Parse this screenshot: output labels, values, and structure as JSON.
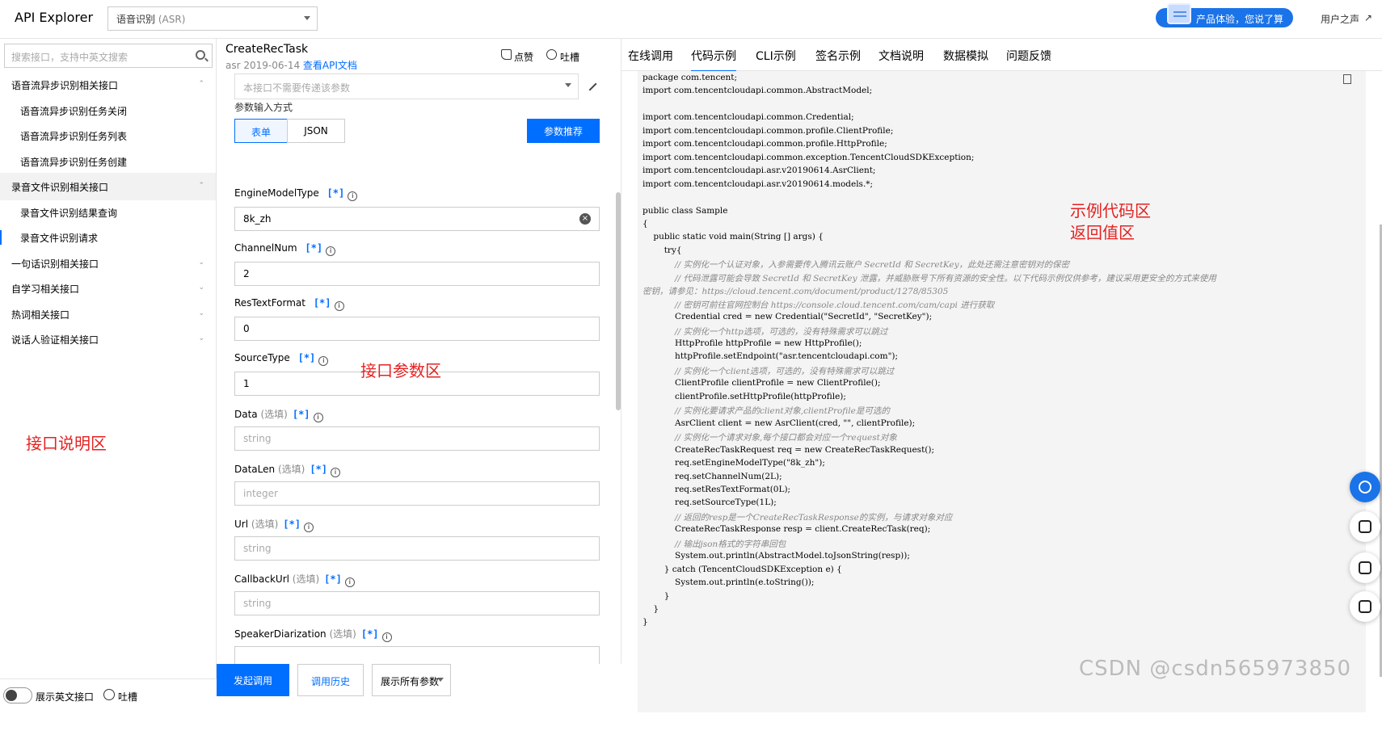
{
  "header": {
    "app_title": "API Explorer",
    "product_select": "语音识别",
    "product_select_sub": "(ASR)",
    "promo": "产品体验，您说了算",
    "voice": "用户之声"
  },
  "sidebar": {
    "search_placeholder": "搜索接口，支持中英文搜索",
    "items": [
      {
        "label": "语音流异步识别相关接口",
        "level": 0,
        "chev": "⌃"
      },
      {
        "label": "语音流异步识别任务关闭",
        "level": 1
      },
      {
        "label": "语音流异步识别任务列表",
        "level": 1
      },
      {
        "label": "语音流异步识别任务创建",
        "level": 1
      },
      {
        "label": "录音文件识别相关接口",
        "level": 0,
        "chev": "⌃"
      },
      {
        "label": "录音文件识别结果查询",
        "level": 1
      },
      {
        "label": "录音文件识别请求",
        "level": 1
      },
      {
        "label": "一句话识别相关接口",
        "level": 0,
        "chev": "⌄"
      },
      {
        "label": "自学习相关接口",
        "level": 0,
        "chev": "⌄"
      },
      {
        "label": "热词相关接口",
        "level": 0,
        "chev": "⌄"
      },
      {
        "label": "说话人验证相关接口",
        "level": 0,
        "chev": "⌄"
      }
    ],
    "note": "接口说明区",
    "toggle_label": "展示英文接口",
    "feedback": "吐槽"
  },
  "middle": {
    "task_title": "CreateRecTask",
    "task_meta": "asr 2019-06-14",
    "doc_link": "查看API文档",
    "like": "点赞",
    "complain": "吐槽",
    "hidden_placeholder": "本接口不需要传递该参数",
    "input_mode_label": "参数输入方式",
    "btn_form": "表单",
    "btn_json": "JSON",
    "btn_recommend": "参数推荐",
    "params": [
      {
        "name": "EngineModelType",
        "opt": "",
        "value": "8k_zh",
        "ph": false
      },
      {
        "name": "ChannelNum",
        "opt": "",
        "value": "2",
        "ph": false
      },
      {
        "name": "ResTextFormat",
        "opt": "",
        "value": "0",
        "ph": false
      },
      {
        "name": "SourceType",
        "opt": "",
        "value": "1",
        "ph": false
      },
      {
        "name": "Data",
        "opt": "(选填)",
        "value": "string",
        "ph": true
      },
      {
        "name": "DataLen",
        "opt": "(选填)",
        "value": "integer",
        "ph": true
      },
      {
        "name": "Url",
        "opt": "(选填)",
        "value": "string",
        "ph": true
      },
      {
        "name": "CallbackUrl",
        "opt": "(选填)",
        "value": "string",
        "ph": true
      },
      {
        "name": "SpeakerDiarization",
        "opt": "(选填)",
        "value": "",
        "ph": true
      }
    ],
    "star": "[*]",
    "note": "接口参数区",
    "btn_send": "发起调用",
    "btn_history": "调用历史",
    "btn_all": "展示所有参数"
  },
  "right": {
    "tabs": [
      "在线调用",
      "代码示例",
      "CLI示例",
      "签名示例",
      "文档说明",
      "数据模拟",
      "问题反馈"
    ],
    "active_tab": 1,
    "note_line1": "示例代码区",
    "note_line2": "返回值区",
    "code_lines": [
      "package com.tencent;",
      "import com.tencentcloudapi.common.AbstractModel;",
      "",
      "import com.tencentcloudapi.common.Credential;",
      "import com.tencentcloudapi.common.profile.ClientProfile;",
      "import com.tencentcloudapi.common.profile.HttpProfile;",
      "import com.tencentcloudapi.common.exception.TencentCloudSDKException;",
      "import com.tencentcloudapi.asr.v20190614.AsrClient;",
      "import com.tencentcloudapi.asr.v20190614.models.*;",
      "",
      "public class Sample",
      "{",
      "    public static void main(String [] args) {",
      "        try{",
      "            // 实例化一个认证对象，入参需要传入腾讯云账户 SecretId 和 SecretKey，此处还需注意密钥对的保密",
      "            // 代码泄露可能会导致 SecretId 和 SecretKey 泄露，并威胁账号下所有资源的安全性。以下代码示例仅供参考，建议采用更安全的方式来使用",
      "密钥，请参见：https://cloud.tencent.com/document/product/1278/85305",
      "            // 密钥可前往官网控制台 https://console.cloud.tencent.com/cam/capi 进行获取",
      "            Credential cred = new Credential(\"SecretId\", \"SecretKey\");",
      "            // 实例化一个http选项，可选的，没有特殊需求可以跳过",
      "            HttpProfile httpProfile = new HttpProfile();",
      "            httpProfile.setEndpoint(\"asr.tencentcloudapi.com\");",
      "            // 实例化一个client选项，可选的，没有特殊需求可以跳过",
      "            ClientProfile clientProfile = new ClientProfile();",
      "            clientProfile.setHttpProfile(httpProfile);",
      "            // 实例化要请求产品的client对象,clientProfile是可选的",
      "            AsrClient client = new AsrClient(cred, \"\", clientProfile);",
      "            // 实例化一个请求对象,每个接口都会对应一个request对象",
      "            CreateRecTaskRequest req = new CreateRecTaskRequest();",
      "            req.setEngineModelType(\"8k_zh\");",
      "            req.setChannelNum(2L);",
      "            req.setResTextFormat(0L);",
      "            req.setSourceType(1L);",
      "            // 返回的resp是一个CreateRecTaskResponse的实例，与请求对象对应",
      "            CreateRecTaskResponse resp = client.CreateRecTask(req);",
      "            // 输出json格式的字符串回包",
      "            System.out.println(AbstractModel.toJsonString(resp));",
      "        } catch (TencentCloudSDKException e) {",
      "            System.out.println(e.toString());",
      "        }",
      "    }",
      "}"
    ]
  },
  "watermark": "CSDN @csdn565973850"
}
